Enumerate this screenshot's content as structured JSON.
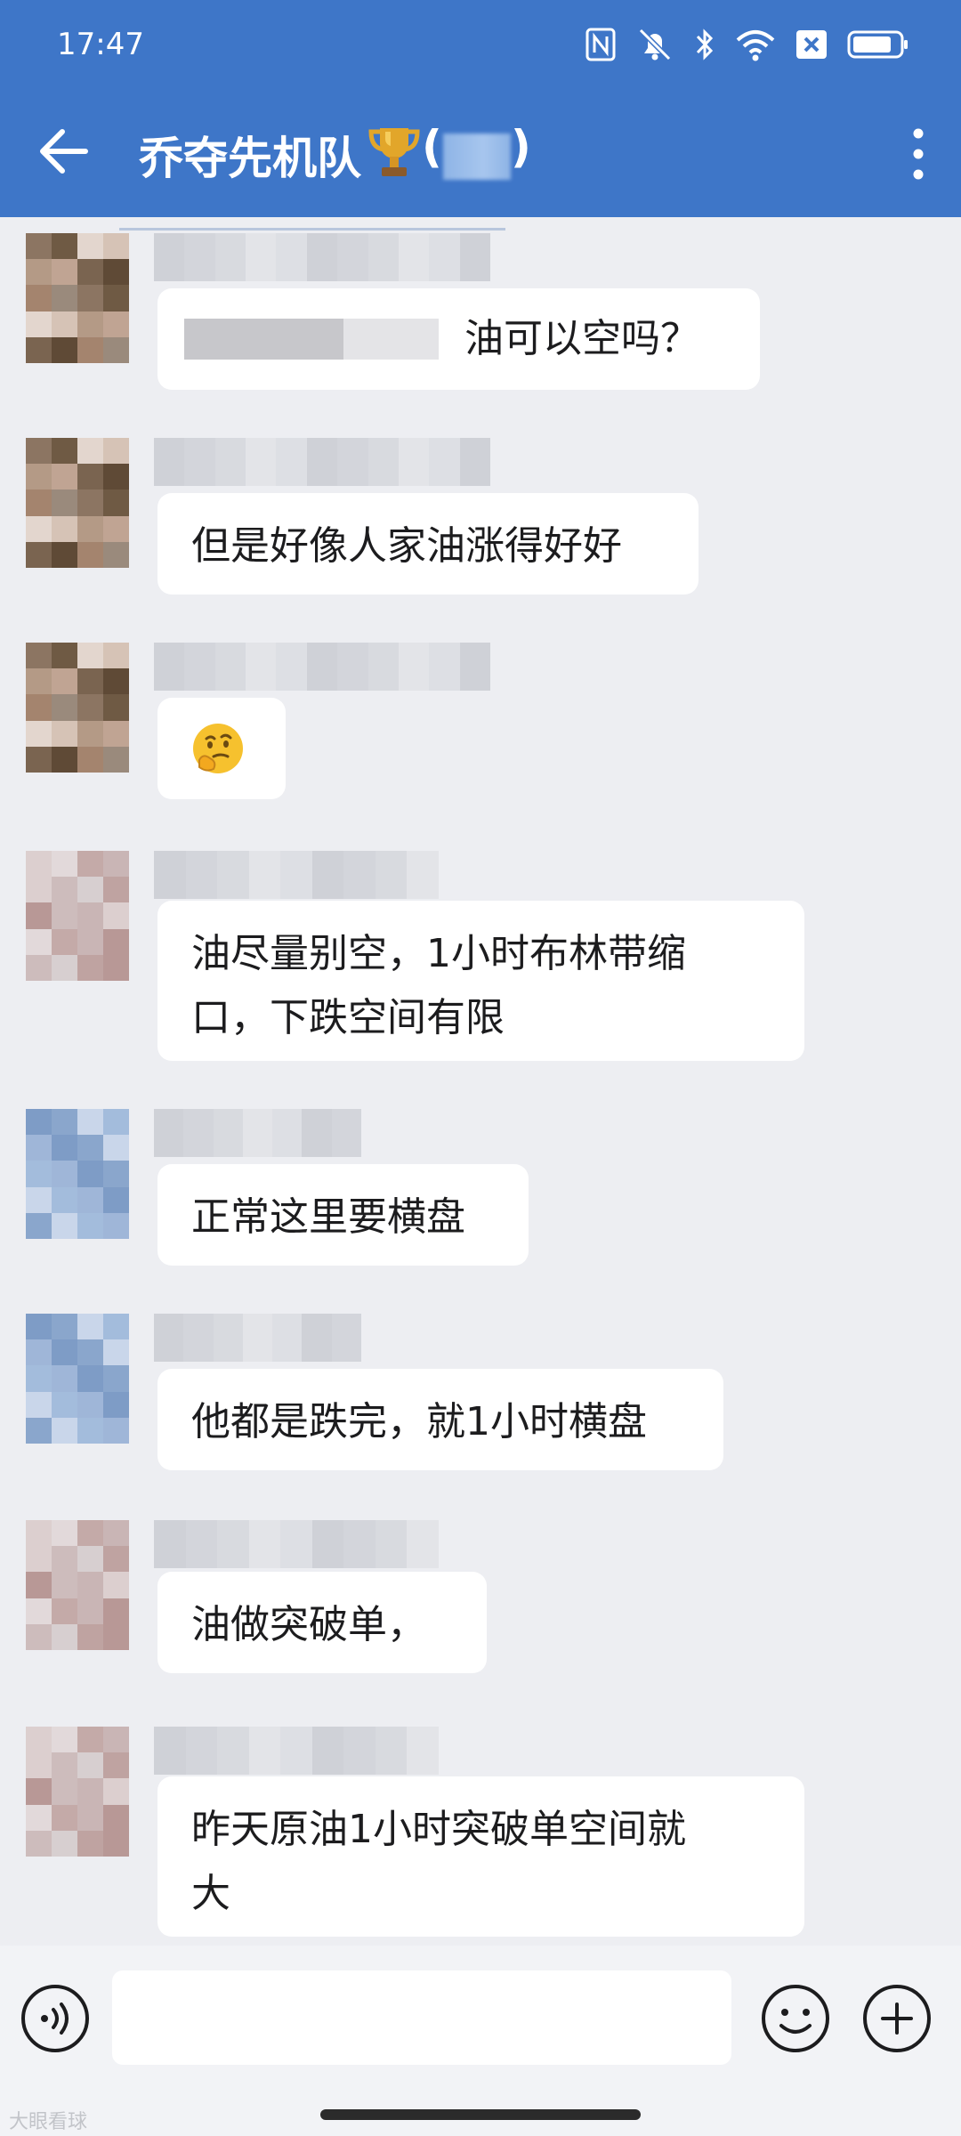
{
  "status_bar": {
    "time": "17:47",
    "icons": [
      "nfc-icon",
      "mute-icon",
      "bluetooth-icon",
      "wifi-icon",
      "sim-off-icon",
      "battery-icon"
    ]
  },
  "header": {
    "title": "乔夺先机队",
    "paren_open": "(",
    "paren_close": ")",
    "back_icon": "back-arrow-icon",
    "title_icon": "trophy-icon",
    "menu_icon": "more-vertical-icon"
  },
  "messages": [
    {
      "text": "油可以空吗？",
      "has_mosaic": true
    },
    {
      "text": "但是好像人家油涨得好好"
    },
    {
      "emoji": "thinking-face-icon"
    },
    {
      "text": "油尽量别空，1小时布林带缩\n口，下跌空间有限"
    },
    {
      "text": "正常这里要横盘"
    },
    {
      "text": "他都是跌完，就1小时横盘"
    },
    {
      "text": "油做突破单，"
    },
    {
      "text": "昨天原油1小时突破单空间就\n大"
    }
  ],
  "input_bar": {
    "placeholder": "",
    "voice_icon": "voice-icon",
    "emoji_icon": "emoji-icon",
    "plus_icon": "plus-icon"
  },
  "watermark": "大眼看球",
  "colors": {
    "header_bg": "#3e76c8",
    "chat_bg": "#edeef2",
    "bubble_bg": "#ffffff",
    "input_bar_bg": "#f2f3f6"
  }
}
